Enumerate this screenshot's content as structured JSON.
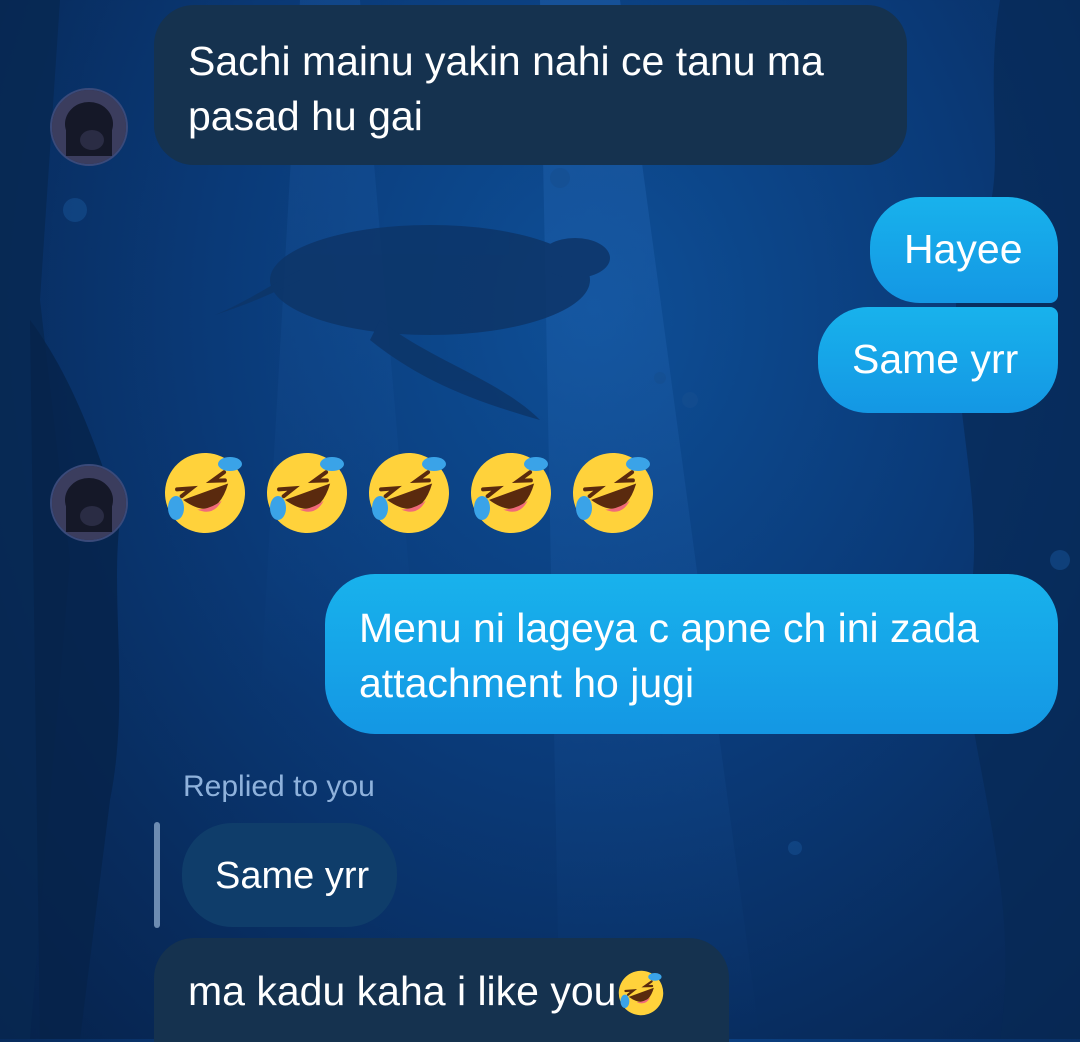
{
  "messages": [
    {
      "direction": "incoming",
      "text_line1": "Sachi mainu yakin nahi ce tanu ma",
      "text_line2": "pasad hu gai"
    },
    {
      "direction": "outgoing",
      "text": "Hayee"
    },
    {
      "direction": "outgoing",
      "text": "Same yrr"
    },
    {
      "direction": "incoming",
      "emoji": "rolling-on-floor-laughing",
      "emoji_count": 5
    },
    {
      "direction": "outgoing",
      "text_line1": "Menu ni lageya c apne ch ini zada",
      "text_line2": "attachment ho jugi"
    },
    {
      "direction": "incoming",
      "reply_label": "Replied to you",
      "quoted_text": "Same yrr"
    },
    {
      "direction": "incoming",
      "text": "ma kadu kaha i like you",
      "trailing_emoji": "rolling-on-floor-laughing"
    }
  ],
  "colors": {
    "incoming_bubble": "#15324f",
    "outgoing_bubble": "#1497e4",
    "quoted_bubble": "#0f3d6a",
    "reply_label": "#8fb2dc"
  }
}
